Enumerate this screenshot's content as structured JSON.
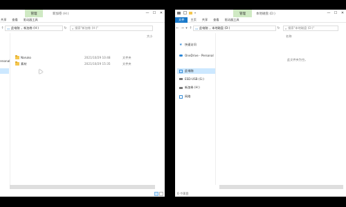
{
  "left_window": {
    "context_tab": "管理",
    "title": "新加卷 (H:)",
    "ribbon_tabs": [
      "共享",
      "查看",
      "驱动器工具"
    ],
    "address": [
      "此电脑",
      "新加卷 (H:)"
    ],
    "search_placeholder": "搜索\"新加卷 (H:)\"",
    "col_size": "大小",
    "nav_partial": "ersonal",
    "files": [
      {
        "name": "Naruko",
        "date": "2021/10/29 10:48",
        "type": "文件夹"
      },
      {
        "name": "素材",
        "date": "2021/10/29 15:35",
        "type": "文件夹"
      }
    ],
    "controls": [
      "—",
      "☐",
      "✕"
    ]
  },
  "right_window": {
    "context_tab": "管理",
    "title": "本地磁盘 (D:)",
    "ribbon_tabs": [
      "文件",
      "主页",
      "共享",
      "查看",
      "驱动器工具"
    ],
    "address": [
      "此电脑",
      "本地磁盘 (D:)"
    ],
    "search_placeholder": "搜索\"本地磁盘 (D:)\"",
    "col_name": "名称",
    "empty_text": "此文件夹为空。",
    "nav_items": [
      {
        "label": "快速访问",
        "icon": "star-icon",
        "color": "#2b87d8"
      },
      {
        "label": "OneDrive - Personal",
        "icon": "cloud-icon",
        "color": "#2b87d8"
      },
      {
        "label": "此电脑",
        "icon": "computer-icon",
        "color": "#3a8fd8",
        "selected": true
      },
      {
        "label": "ESD-USB (G:)",
        "icon": "usb-drive-icon",
        "color": "#777777"
      },
      {
        "label": "新加卷 (H:)",
        "icon": "drive-icon",
        "color": "#777777"
      },
      {
        "label": "网络",
        "icon": "network-icon",
        "color": "#3a8fd8"
      }
    ],
    "status": "0 个项目",
    "controls": [
      "—",
      "☐",
      "✕"
    ]
  },
  "colors": {
    "accent": "#1979ca",
    "context_tab": "#cfe9c3",
    "folder": "#f4c64e",
    "selection": "#cce8ff"
  }
}
